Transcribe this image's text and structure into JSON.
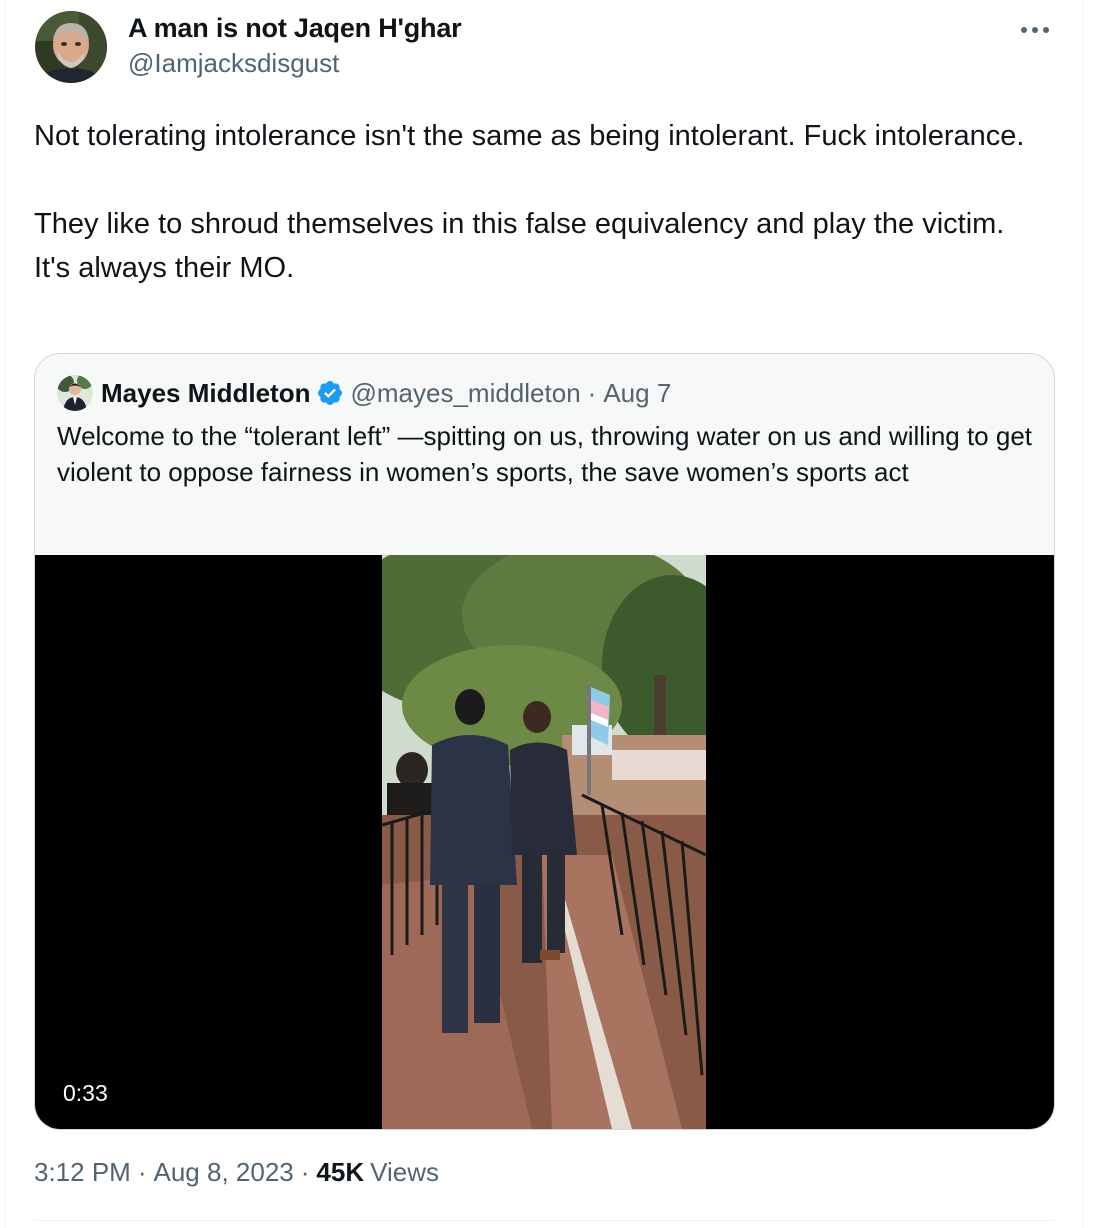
{
  "tweet": {
    "author": {
      "name": "A man is not Jaqen H'ghar",
      "handle": "@Iamjacksdisgust",
      "avatar_icon": "user-avatar-photo"
    },
    "more_icon": "more-horizontal-icon",
    "text": "Not tolerating intolerance isn't the same as being intolerant. Fuck intolerance.\n\nThey like to shroud themselves in this false equivalency and play the victim. It's always their MO.",
    "quoted": {
      "author_name": "Mayes Middleton",
      "verified_icon": "verified-badge-icon",
      "handle": "@mayes_middleton",
      "separator": "·",
      "date": "Aug 7",
      "text": "Welcome to the “tolerant left” —spitting on us, throwing water on us and willing to get violent to oppose fairness in women’s sports, the save women’s sports act",
      "video": {
        "duration": "0:33"
      }
    },
    "meta": {
      "time": "3:12 PM",
      "separator": "·",
      "date": "Aug 8, 2023",
      "views_count": "45K",
      "views_label": "Views"
    }
  },
  "colors": {
    "text_primary": "#0f1419",
    "text_secondary": "#536471",
    "verified_blue": "#1d9bf0",
    "border": "#cfd9de",
    "quote_bg": "#f7f8f8"
  }
}
